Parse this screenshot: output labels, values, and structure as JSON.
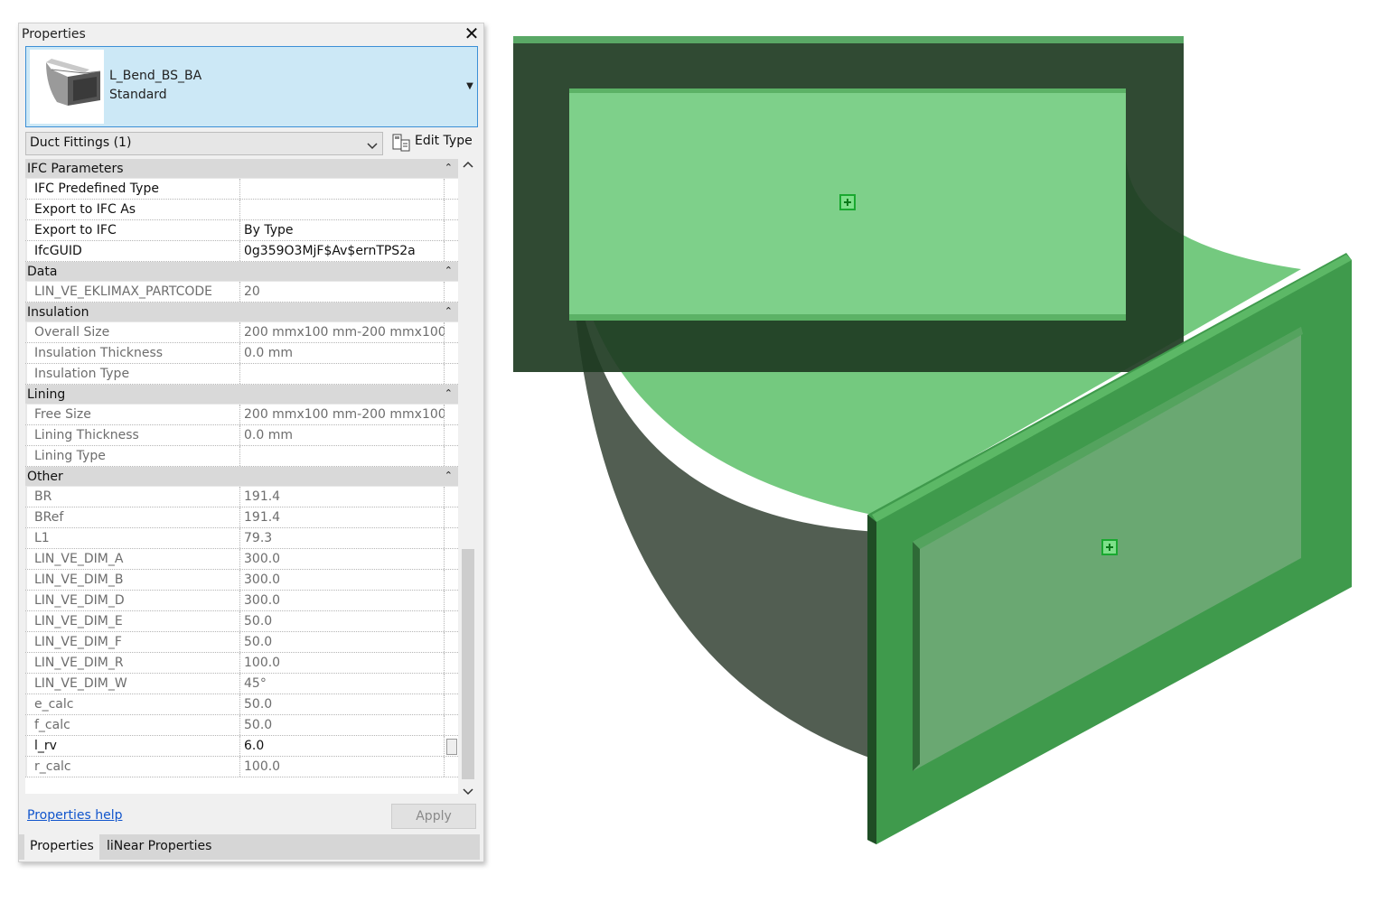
{
  "panel": {
    "title": "Properties",
    "type_selector": {
      "family": "L_Bend_BS_BA",
      "type": "Standard"
    },
    "filter": {
      "label": "Duct Fittings (1)"
    },
    "edit_type_label": "Edit Type",
    "groups": [
      {
        "label": "IFC Parameters",
        "rows": [
          {
            "name": "IFC Predefined Type",
            "value": "",
            "editable": true
          },
          {
            "name": "Export to IFC As",
            "value": "",
            "editable": true
          },
          {
            "name": "Export to IFC",
            "value": "By Type",
            "editable": true
          },
          {
            "name": "IfcGUID",
            "value": "0g359O3MjF$Av$ernTPS2a",
            "editable": true
          }
        ]
      },
      {
        "label": "Data",
        "rows": [
          {
            "name": "LIN_VE_EKLIMAX_PARTCODE",
            "value": "20",
            "editable": false
          }
        ]
      },
      {
        "label": "Insulation",
        "rows": [
          {
            "name": "Overall Size",
            "value": "200 mmx100 mm-200 mmx100...",
            "editable": false
          },
          {
            "name": "Insulation Thickness",
            "value": "0.0 mm",
            "editable": false
          },
          {
            "name": "Insulation Type",
            "value": "",
            "editable": false
          }
        ]
      },
      {
        "label": "Lining",
        "rows": [
          {
            "name": "Free Size",
            "value": "200 mmx100 mm-200 mmx100...",
            "editable": false
          },
          {
            "name": "Lining Thickness",
            "value": "0.0 mm",
            "editable": false
          },
          {
            "name": "Lining Type",
            "value": "",
            "editable": false
          }
        ]
      },
      {
        "label": "Other",
        "rows": [
          {
            "name": "BR",
            "value": "191.4",
            "editable": false
          },
          {
            "name": "BRef",
            "value": "191.4",
            "editable": false
          },
          {
            "name": "L1",
            "value": "79.3",
            "editable": false
          },
          {
            "name": "LIN_VE_DIM_A",
            "value": "300.0",
            "editable": false
          },
          {
            "name": "LIN_VE_DIM_B",
            "value": "300.0",
            "editable": false
          },
          {
            "name": "LIN_VE_DIM_D",
            "value": "300.0",
            "editable": false
          },
          {
            "name": "LIN_VE_DIM_E",
            "value": "50.0",
            "editable": false
          },
          {
            "name": "LIN_VE_DIM_F",
            "value": "50.0",
            "editable": false
          },
          {
            "name": "LIN_VE_DIM_R",
            "value": "100.0",
            "editable": false
          },
          {
            "name": "LIN_VE_DIM_W",
            "value": "45°",
            "editable": false
          },
          {
            "name": "e_calc",
            "value": "50.0",
            "editable": false
          },
          {
            "name": "f_calc",
            "value": "50.0",
            "editable": false
          },
          {
            "name": "l_rv",
            "value": "6.0",
            "editable": true
          },
          {
            "name": "r_calc",
            "value": "100.0",
            "editable": false
          }
        ]
      }
    ],
    "help_link": "Properties help",
    "apply_label": "Apply",
    "tabs": [
      {
        "label": "Properties"
      },
      {
        "label": "liNear Properties"
      }
    ]
  }
}
